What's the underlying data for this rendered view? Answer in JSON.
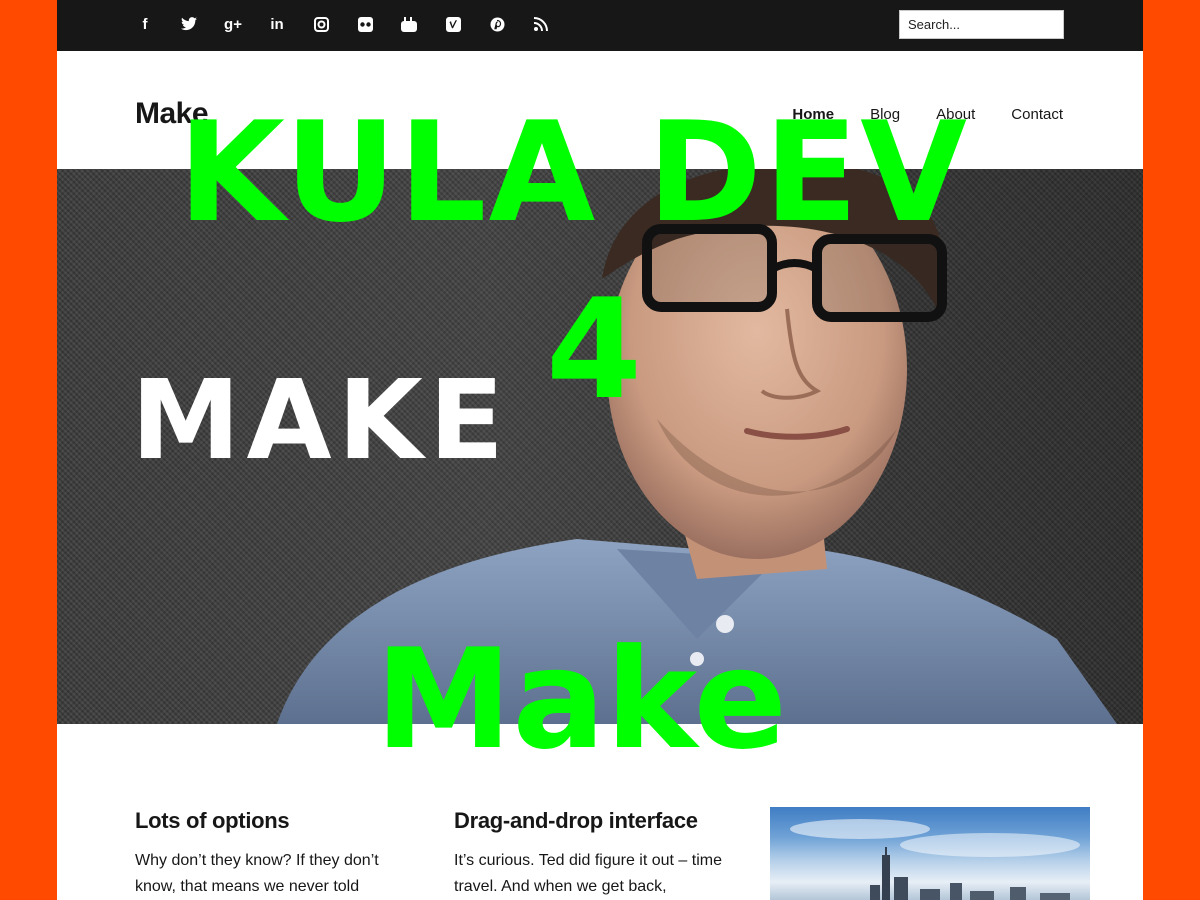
{
  "topbar": {
    "social_icons": [
      "facebook-icon",
      "twitter-icon",
      "google-plus-icon",
      "linkedin-icon",
      "instagram-icon",
      "flickr-icon",
      "youtube-icon",
      "vimeo-icon",
      "pinterest-icon",
      "rss-icon"
    ],
    "search_placeholder": "Search..."
  },
  "header": {
    "brand": "Make",
    "nav": [
      "Home",
      "Blog",
      "About",
      "Contact"
    ],
    "active_nav": "Home"
  },
  "features": [
    {
      "title": "Lots of options",
      "text": "Why don’t they know? If they don’t know, that means we never told"
    },
    {
      "title": "Drag-and-drop interface",
      "text": "It’s curious. Ted did figure it out – time travel. And when we get back,"
    }
  ],
  "overlays": {
    "line1": "KULA DEV",
    "line2": "4",
    "white_title": "MAKE",
    "bottom": "Make"
  },
  "colors": {
    "frame": "#ff4a00",
    "topbar": "#171717",
    "overlay_green": "#00ff00"
  }
}
